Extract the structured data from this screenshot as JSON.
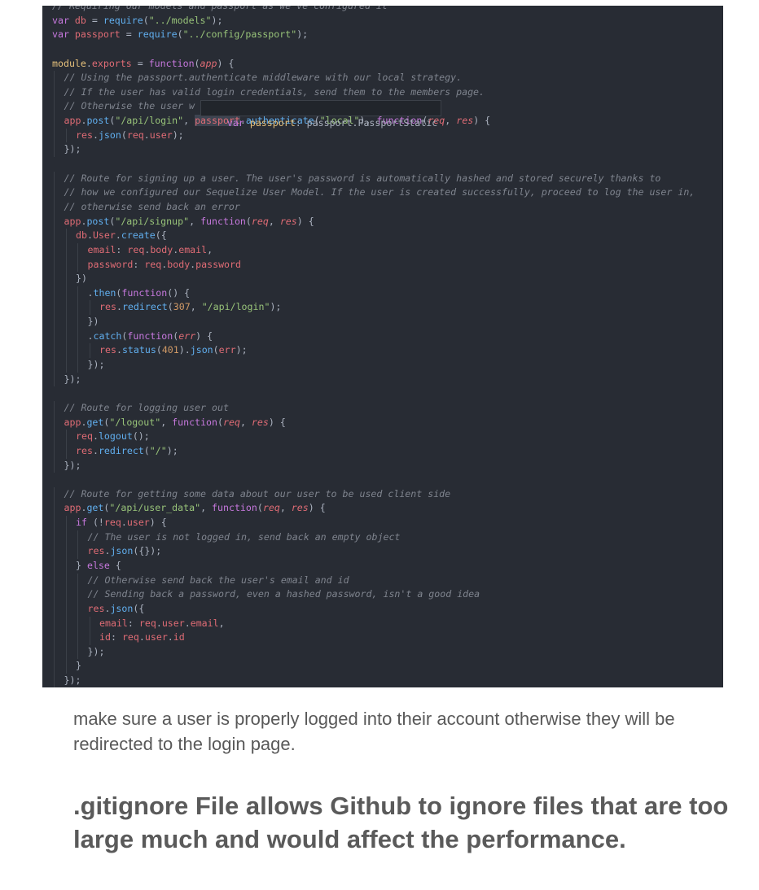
{
  "code_lines": [
    {
      "indent": 0,
      "parts": [
        [
          "cmt",
          "// Requiring our models and passport as we've configured it"
        ]
      ]
    },
    {
      "indent": 0,
      "parts": [
        [
          "kw",
          "var "
        ],
        [
          "var",
          "db"
        ],
        [
          "pln",
          " = "
        ],
        [
          "fn",
          "require"
        ],
        [
          "pln",
          "("
        ],
        [
          "str",
          "\"../models\""
        ],
        [
          "pln",
          ");"
        ]
      ]
    },
    {
      "indent": 0,
      "parts": [
        [
          "kw",
          "var "
        ],
        [
          "var",
          "passport"
        ],
        [
          "pln",
          " = "
        ],
        [
          "fn",
          "require"
        ],
        [
          "pln",
          "("
        ],
        [
          "str",
          "\"../config/passport\""
        ],
        [
          "pln",
          ");"
        ]
      ]
    },
    {
      "indent": 0,
      "parts": []
    },
    {
      "indent": 0,
      "parts": [
        [
          "hover",
          "module"
        ],
        [
          "pln",
          "."
        ],
        [
          "var",
          "exports"
        ],
        [
          "pln",
          " = "
        ],
        [
          "kw",
          "function"
        ],
        [
          "pln",
          "("
        ],
        [
          "par",
          "app"
        ],
        [
          "pln",
          ") {"
        ]
      ]
    },
    {
      "indent": 1,
      "parts": [
        [
          "cmt",
          "// Using the passport.authenticate middleware with our local strategy."
        ]
      ]
    },
    {
      "indent": 1,
      "parts": [
        [
          "cmt",
          "// If the user has valid login credentials, send them to the members page."
        ]
      ]
    },
    {
      "indent": 1,
      "parts": [
        [
          "cmt",
          "// Otherwise the user w"
        ]
      ]
    },
    {
      "indent": 1,
      "parts": [
        [
          "var",
          "app"
        ],
        [
          "pln",
          "."
        ],
        [
          "fn",
          "post"
        ],
        [
          "pln",
          "("
        ],
        [
          "str",
          "\"/api/login\""
        ],
        [
          "pln",
          ", "
        ],
        [
          "hl",
          "passport"
        ],
        [
          "pln",
          "."
        ],
        [
          "fn",
          "authenticate"
        ],
        [
          "pln",
          "("
        ],
        [
          "str",
          "\"local\""
        ],
        [
          "pln",
          "), "
        ],
        [
          "kw",
          "function"
        ],
        [
          "pln",
          "("
        ],
        [
          "par",
          "req"
        ],
        [
          "pln",
          ", "
        ],
        [
          "par",
          "res"
        ],
        [
          "pln",
          ") {"
        ]
      ]
    },
    {
      "indent": 2,
      "parts": [
        [
          "var",
          "res"
        ],
        [
          "pln",
          "."
        ],
        [
          "fn",
          "json"
        ],
        [
          "pln",
          "("
        ],
        [
          "var",
          "req"
        ],
        [
          "pln",
          "."
        ],
        [
          "var",
          "user"
        ],
        [
          "pln",
          ");"
        ]
      ]
    },
    {
      "indent": 1,
      "parts": [
        [
          "pln",
          "});"
        ]
      ]
    },
    {
      "indent": 0,
      "parts": []
    },
    {
      "indent": 1,
      "parts": [
        [
          "cmt",
          "// Route for signing up a user. The user's password is automatically hashed and stored securely thanks to"
        ]
      ]
    },
    {
      "indent": 1,
      "parts": [
        [
          "cmt",
          "// how we configured our Sequelize User Model. If the user is created successfully, proceed to log the user in,"
        ]
      ]
    },
    {
      "indent": 1,
      "parts": [
        [
          "cmt",
          "// otherwise send back an error"
        ]
      ]
    },
    {
      "indent": 1,
      "parts": [
        [
          "var",
          "app"
        ],
        [
          "pln",
          "."
        ],
        [
          "fn",
          "post"
        ],
        [
          "pln",
          "("
        ],
        [
          "str",
          "\"/api/signup\""
        ],
        [
          "pln",
          ", "
        ],
        [
          "kw",
          "function"
        ],
        [
          "pln",
          "("
        ],
        [
          "par",
          "req"
        ],
        [
          "pln",
          ", "
        ],
        [
          "par",
          "res"
        ],
        [
          "pln",
          ") {"
        ]
      ]
    },
    {
      "indent": 2,
      "parts": [
        [
          "var",
          "db"
        ],
        [
          "pln",
          "."
        ],
        [
          "var",
          "User"
        ],
        [
          "pln",
          "."
        ],
        [
          "fn",
          "create"
        ],
        [
          "pln",
          "({"
        ]
      ]
    },
    {
      "indent": 3,
      "parts": [
        [
          "var",
          "email"
        ],
        [
          "pln",
          ": "
        ],
        [
          "var",
          "req"
        ],
        [
          "pln",
          "."
        ],
        [
          "var",
          "body"
        ],
        [
          "pln",
          "."
        ],
        [
          "var",
          "email"
        ],
        [
          "pln",
          ","
        ]
      ]
    },
    {
      "indent": 3,
      "parts": [
        [
          "var",
          "password"
        ],
        [
          "pln",
          ": "
        ],
        [
          "var",
          "req"
        ],
        [
          "pln",
          "."
        ],
        [
          "var",
          "body"
        ],
        [
          "pln",
          "."
        ],
        [
          "var",
          "password"
        ]
      ]
    },
    {
      "indent": 2,
      "parts": [
        [
          "pln",
          "})"
        ]
      ]
    },
    {
      "indent": 3,
      "parts": [
        [
          "pln",
          "."
        ],
        [
          "fn",
          "then"
        ],
        [
          "pln",
          "("
        ],
        [
          "kw",
          "function"
        ],
        [
          "pln",
          "() {"
        ]
      ]
    },
    {
      "indent": 4,
      "parts": [
        [
          "var",
          "res"
        ],
        [
          "pln",
          "."
        ],
        [
          "fn",
          "redirect"
        ],
        [
          "pln",
          "("
        ],
        [
          "num",
          "307"
        ],
        [
          "pln",
          ", "
        ],
        [
          "str",
          "\"/api/login\""
        ],
        [
          "pln",
          ");"
        ]
      ]
    },
    {
      "indent": 3,
      "parts": [
        [
          "pln",
          "})"
        ]
      ]
    },
    {
      "indent": 3,
      "parts": [
        [
          "pln",
          "."
        ],
        [
          "fn",
          "catch"
        ],
        [
          "pln",
          "("
        ],
        [
          "kw",
          "function"
        ],
        [
          "pln",
          "("
        ],
        [
          "par",
          "err"
        ],
        [
          "pln",
          ") {"
        ]
      ]
    },
    {
      "indent": 4,
      "parts": [
        [
          "var",
          "res"
        ],
        [
          "pln",
          "."
        ],
        [
          "fn",
          "status"
        ],
        [
          "pln",
          "("
        ],
        [
          "num",
          "401"
        ],
        [
          "pln",
          ")."
        ],
        [
          "fn",
          "json"
        ],
        [
          "pln",
          "("
        ],
        [
          "var",
          "err"
        ],
        [
          "pln",
          ");"
        ]
      ]
    },
    {
      "indent": 3,
      "parts": [
        [
          "pln",
          "});"
        ]
      ]
    },
    {
      "indent": 1,
      "parts": [
        [
          "pln",
          "});"
        ]
      ]
    },
    {
      "indent": 0,
      "parts": []
    },
    {
      "indent": 1,
      "parts": [
        [
          "cmt",
          "// Route for logging user out"
        ]
      ]
    },
    {
      "indent": 1,
      "parts": [
        [
          "var",
          "app"
        ],
        [
          "pln",
          "."
        ],
        [
          "fn",
          "get"
        ],
        [
          "pln",
          "("
        ],
        [
          "str",
          "\"/logout\""
        ],
        [
          "pln",
          ", "
        ],
        [
          "kw",
          "function"
        ],
        [
          "pln",
          "("
        ],
        [
          "par",
          "req"
        ],
        [
          "pln",
          ", "
        ],
        [
          "par",
          "res"
        ],
        [
          "pln",
          ") {"
        ]
      ]
    },
    {
      "indent": 2,
      "parts": [
        [
          "var",
          "req"
        ],
        [
          "pln",
          "."
        ],
        [
          "fn",
          "logout"
        ],
        [
          "pln",
          "();"
        ]
      ]
    },
    {
      "indent": 2,
      "parts": [
        [
          "var",
          "res"
        ],
        [
          "pln",
          "."
        ],
        [
          "fn",
          "redirect"
        ],
        [
          "pln",
          "("
        ],
        [
          "str",
          "\"/\""
        ],
        [
          "pln",
          ");"
        ]
      ]
    },
    {
      "indent": 1,
      "parts": [
        [
          "pln",
          "});"
        ]
      ]
    },
    {
      "indent": 0,
      "parts": []
    },
    {
      "indent": 1,
      "parts": [
        [
          "cmt",
          "// Route for getting some data about our user to be used client side"
        ]
      ]
    },
    {
      "indent": 1,
      "parts": [
        [
          "var",
          "app"
        ],
        [
          "pln",
          "."
        ],
        [
          "fn",
          "get"
        ],
        [
          "pln",
          "("
        ],
        [
          "str",
          "\"/api/user_data\""
        ],
        [
          "pln",
          ", "
        ],
        [
          "kw",
          "function"
        ],
        [
          "pln",
          "("
        ],
        [
          "par",
          "req"
        ],
        [
          "pln",
          ", "
        ],
        [
          "par",
          "res"
        ],
        [
          "pln",
          ") {"
        ]
      ]
    },
    {
      "indent": 2,
      "parts": [
        [
          "kw",
          "if"
        ],
        [
          "pln",
          " (!"
        ],
        [
          "var",
          "req"
        ],
        [
          "pln",
          "."
        ],
        [
          "var",
          "user"
        ],
        [
          "pln",
          ") {"
        ]
      ]
    },
    {
      "indent": 3,
      "parts": [
        [
          "cmt",
          "// The user is not logged in, send back an empty object"
        ]
      ]
    },
    {
      "indent": 3,
      "parts": [
        [
          "var",
          "res"
        ],
        [
          "pln",
          "."
        ],
        [
          "fn",
          "json"
        ],
        [
          "pln",
          "({});"
        ]
      ]
    },
    {
      "indent": 2,
      "parts": [
        [
          "pln",
          "} "
        ],
        [
          "kw",
          "else"
        ],
        [
          "pln",
          " {"
        ]
      ]
    },
    {
      "indent": 3,
      "parts": [
        [
          "cmt",
          "// Otherwise send back the user's email and id"
        ]
      ]
    },
    {
      "indent": 3,
      "parts": [
        [
          "cmt",
          "// Sending back a password, even a hashed password, isn't a good idea"
        ]
      ]
    },
    {
      "indent": 3,
      "parts": [
        [
          "var",
          "res"
        ],
        [
          "pln",
          "."
        ],
        [
          "fn",
          "json"
        ],
        [
          "pln",
          "({"
        ]
      ]
    },
    {
      "indent": 4,
      "parts": [
        [
          "var",
          "email"
        ],
        [
          "pln",
          ": "
        ],
        [
          "var",
          "req"
        ],
        [
          "pln",
          "."
        ],
        [
          "var",
          "user"
        ],
        [
          "pln",
          "."
        ],
        [
          "var",
          "email"
        ],
        [
          "pln",
          ","
        ]
      ]
    },
    {
      "indent": 4,
      "parts": [
        [
          "var",
          "id"
        ],
        [
          "pln",
          ": "
        ],
        [
          "var",
          "req"
        ],
        [
          "pln",
          "."
        ],
        [
          "var",
          "user"
        ],
        [
          "pln",
          "."
        ],
        [
          "var",
          "id"
        ]
      ]
    },
    {
      "indent": 3,
      "parts": [
        [
          "pln",
          "});"
        ]
      ]
    },
    {
      "indent": 2,
      "parts": [
        [
          "pln",
          "}"
        ]
      ]
    },
    {
      "indent": 1,
      "parts": [
        [
          "pln",
          "});"
        ]
      ]
    }
  ],
  "tooltip": {
    "kw": "var ",
    "name": "passport",
    "sep": ": ",
    "type": "passport.PassportStatic"
  },
  "description": "make sure a user is properly logged into their account otherwise they will be redirected to the login page.",
  "heading": ".gitignore File allows Github to ignore files that are too large much and would affect the performance.",
  "colors": {
    "editor_bg": "#282c34",
    "keyword": "#c678dd",
    "variable": "#e06c75",
    "string": "#98c379",
    "function": "#61afef",
    "number": "#d19a66",
    "comment": "#7f848e"
  }
}
